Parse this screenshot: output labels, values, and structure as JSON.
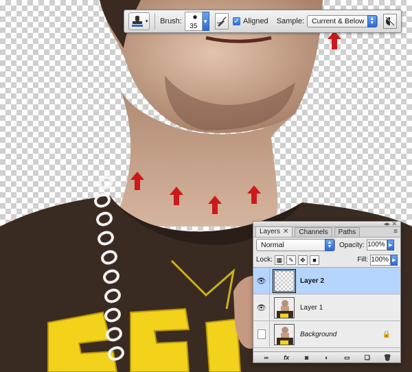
{
  "options_bar": {
    "tool_icon": "clone-stamp-icon",
    "brush_label": "Brush:",
    "brush_size": "35",
    "aligned_label": "Aligned",
    "aligned_checked": true,
    "sample_label": "Sample:",
    "sample_value": "Current & Below",
    "ignore_adjustment_icon": "ignore-adjustment-layers-icon",
    "airbrush_icon": "pressure-icon"
  },
  "annotations": {
    "arrow_color": "#cc1a1a",
    "arrow_icon": "up-arrow-icon"
  },
  "layers_panel": {
    "tabs": [
      {
        "label": "Layers",
        "active": true,
        "close": "✕"
      },
      {
        "label": "Channels",
        "active": false
      },
      {
        "label": "Paths",
        "active": false
      }
    ],
    "blend_mode": "Normal",
    "opacity_label": "Opacity:",
    "opacity_value": "100%",
    "lock_label": "Lock:",
    "fill_label": "Fill:",
    "fill_value": "100%",
    "layers": [
      {
        "name": "Layer 2",
        "visible": true,
        "selected": true,
        "thumb": "transparent"
      },
      {
        "name": "Layer 1",
        "visible": true,
        "selected": false,
        "thumb": "photo"
      },
      {
        "name": "Background",
        "visible": false,
        "selected": false,
        "thumb": "photo",
        "locked": true
      }
    ],
    "footer_icons": [
      "link-layers-icon",
      "fx-icon",
      "add-mask-icon",
      "adjustment-layer-icon",
      "new-group-icon",
      "new-layer-icon",
      "delete-layer-icon"
    ],
    "fx_label": "fx"
  },
  "colors": {
    "accent": "#2c6ad6",
    "selection": "#b5d5ff",
    "shirt": "#3a2b22",
    "skin": "#c79f86"
  }
}
